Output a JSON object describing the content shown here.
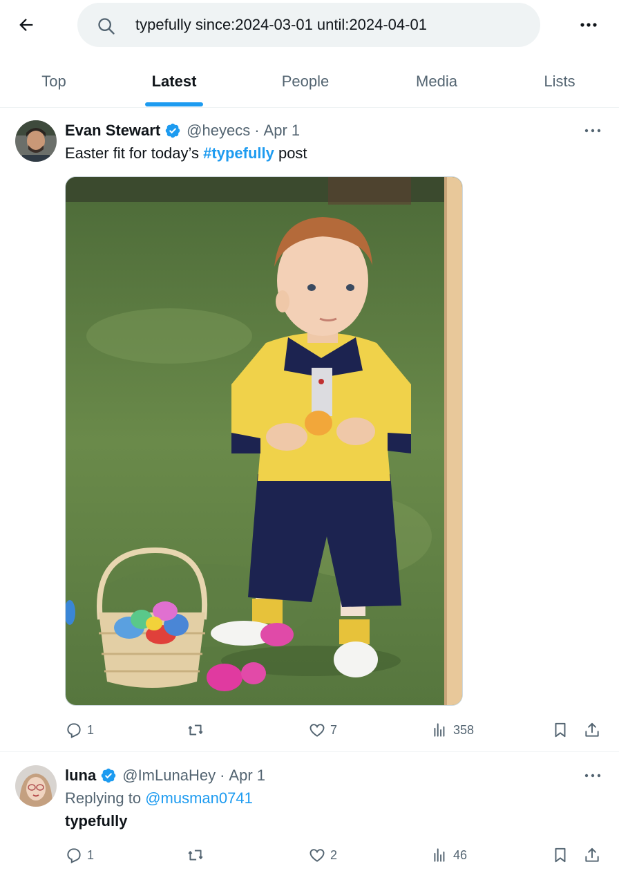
{
  "search": {
    "query": "typefully since:2024-03-01 until:2024-04-01"
  },
  "tabs": [
    {
      "label": "Top",
      "active": false
    },
    {
      "label": "Latest",
      "active": true
    },
    {
      "label": "People",
      "active": false
    },
    {
      "label": "Media",
      "active": false
    },
    {
      "label": "Lists",
      "active": false
    }
  ],
  "tweets": [
    {
      "name": "Evan Stewart",
      "handle": "@heyecs",
      "separator": "·",
      "time": "Apr 1",
      "text_before": "Easter fit for today’s ",
      "hashtag": "#typefully",
      "text_after": " post",
      "replies": "1",
      "reposts": "",
      "likes": "7",
      "views": "358"
    },
    {
      "name": "luna",
      "handle": "@ImLunaHey",
      "separator": "·",
      "time": "Apr 1",
      "replying_prefix": "Replying to ",
      "replying_to": "@musman0741",
      "text": "typefully",
      "replies": "1",
      "reposts": "",
      "likes": "2",
      "views": "46"
    }
  ],
  "colors": {
    "accent": "#1d9bf0",
    "text": "#0f1419",
    "muted": "#536471",
    "search_bg": "#eff3f4"
  }
}
